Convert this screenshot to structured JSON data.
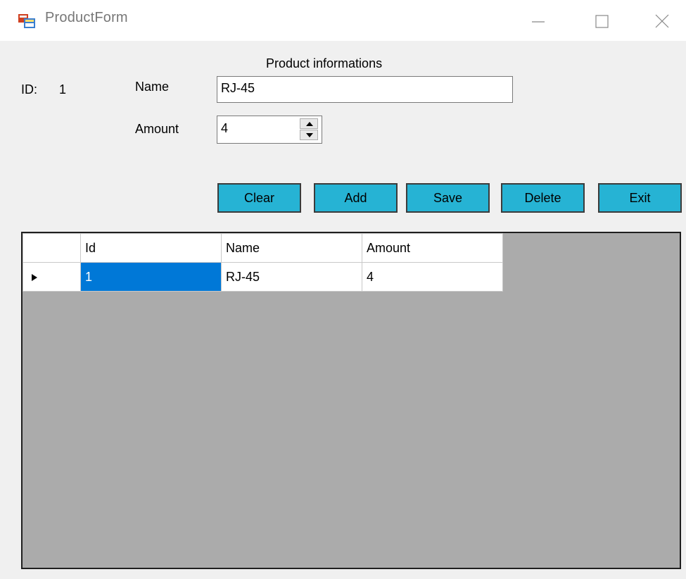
{
  "window": {
    "title": "ProductForm",
    "icon": "winforms-app-icon",
    "controls": [
      "minimize-icon",
      "maximize-icon",
      "close-icon"
    ]
  },
  "form": {
    "heading": "Product informations",
    "id_label": "ID:",
    "id_value": "1",
    "name_label": "Name",
    "name_value": "RJ-45",
    "amount_label": "Amount",
    "amount_value": "4"
  },
  "buttons": {
    "clear": "Clear",
    "add": "Add",
    "save": "Save",
    "delete": "Delete",
    "exit": "Exit",
    "color": "#26b3d4"
  },
  "grid": {
    "columns": [
      "Id",
      "Name",
      "Amount"
    ],
    "rows": [
      {
        "id": "1",
        "name": "RJ-45",
        "amount": "4"
      }
    ],
    "selection_color": "#0078d7",
    "background_color": "#ababab"
  }
}
